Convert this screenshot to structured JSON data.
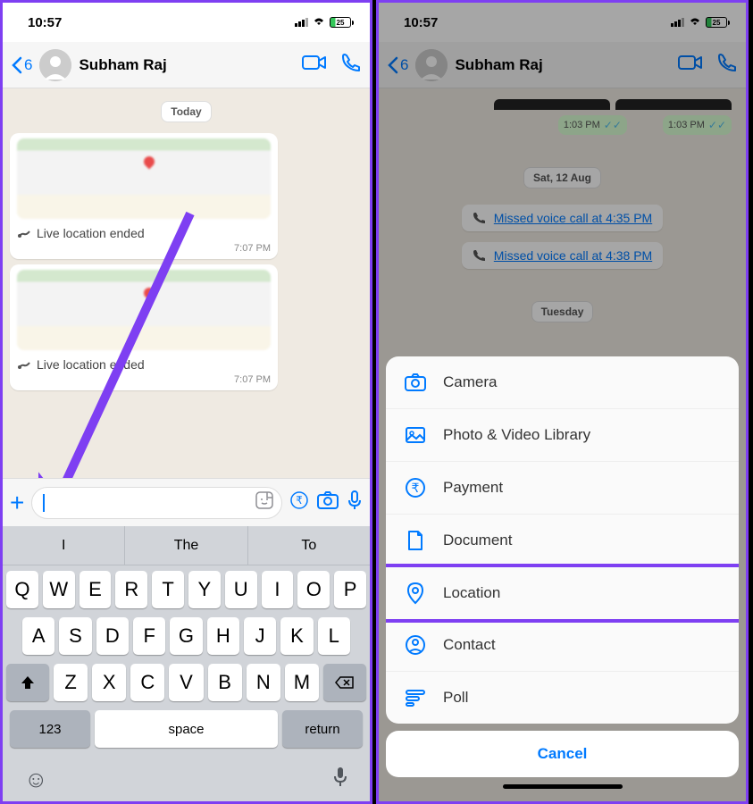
{
  "status": {
    "time": "10:57",
    "battery": "25"
  },
  "header": {
    "back_count": "6",
    "name": "Subham Raj"
  },
  "left": {
    "date": "Today",
    "loc_text": "Live location ended",
    "ts": "7:07 PM",
    "suggestions": [
      "I",
      "The",
      "To"
    ],
    "kb": {
      "row1": [
        "Q",
        "W",
        "E",
        "R",
        "T",
        "Y",
        "U",
        "I",
        "O",
        "P"
      ],
      "row2": [
        "A",
        "S",
        "D",
        "F",
        "G",
        "H",
        "J",
        "K",
        "L"
      ],
      "row3": [
        "Z",
        "X",
        "C",
        "V",
        "B",
        "N",
        "M"
      ],
      "num": "123",
      "space": "space",
      "return": "return"
    }
  },
  "right": {
    "out_ts": "1:03 PM",
    "date1": "Sat, 12 Aug",
    "missed1": "Missed voice call at 4:35 PM",
    "missed2": "Missed voice call at 4:38 PM",
    "date2": "Tuesday",
    "sheet": {
      "camera": "Camera",
      "photo": "Photo & Video Library",
      "payment": "Payment",
      "document": "Document",
      "location": "Location",
      "contact": "Contact",
      "poll": "Poll",
      "cancel": "Cancel"
    }
  }
}
